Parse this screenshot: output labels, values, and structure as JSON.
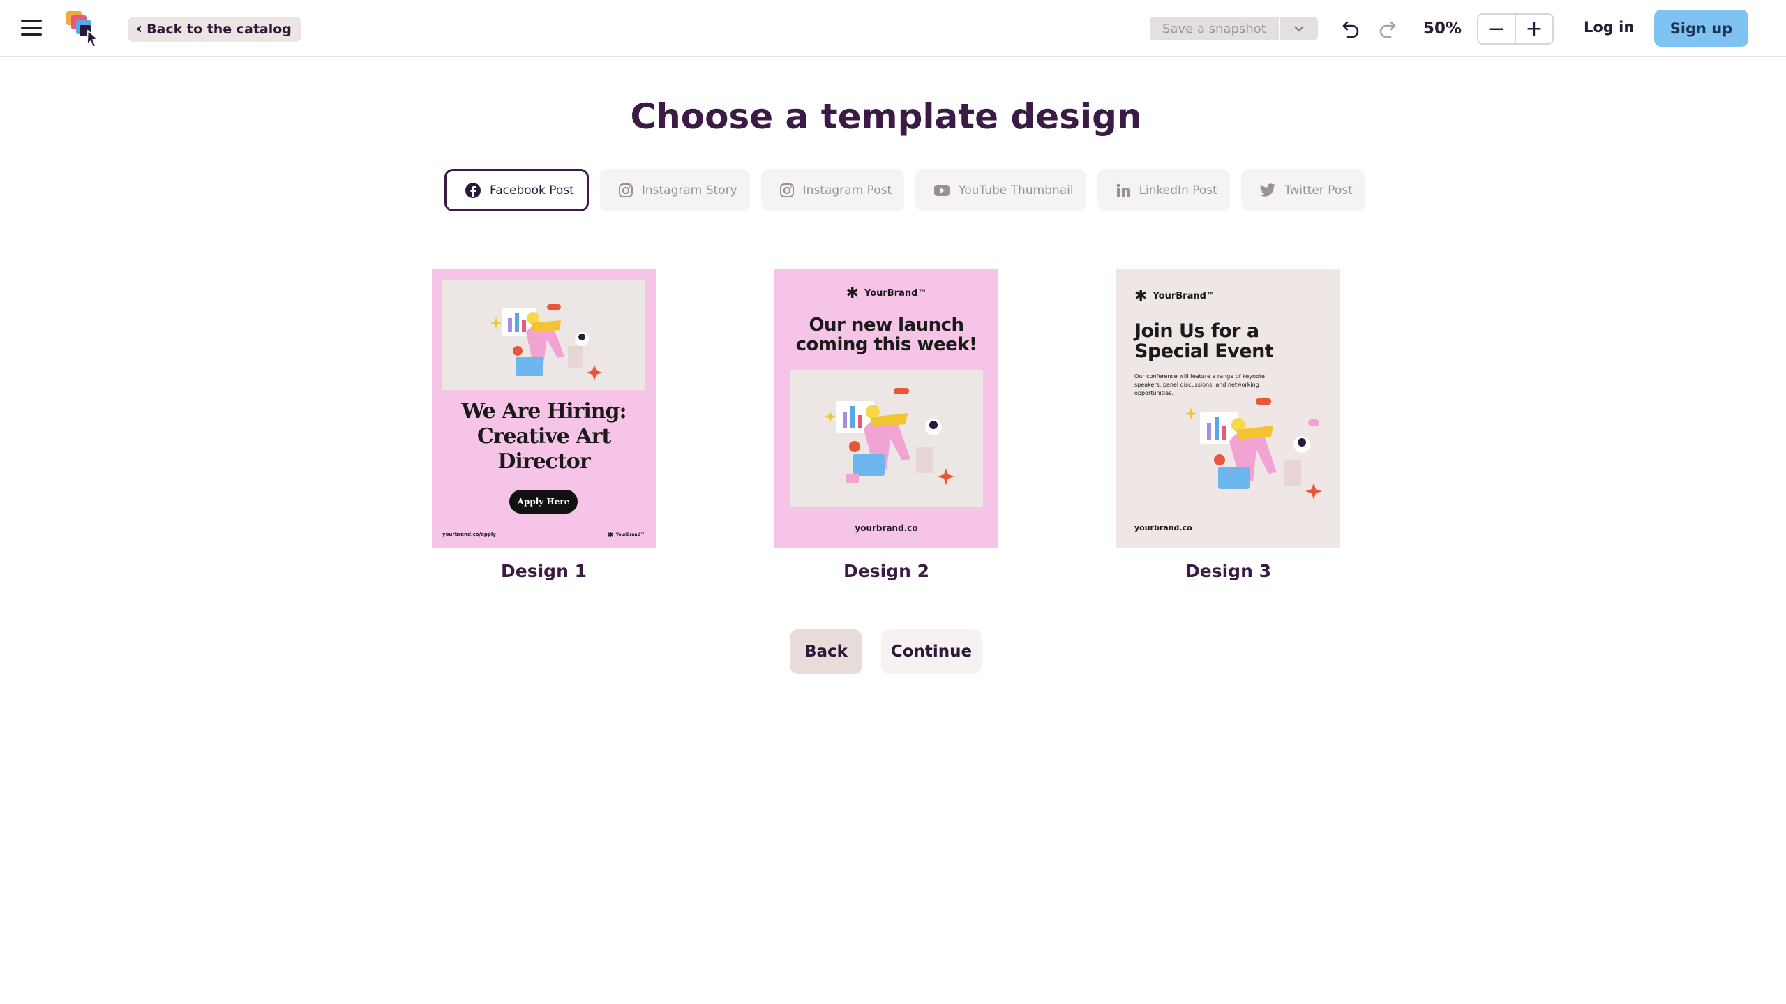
{
  "header": {
    "back_to_catalog": "Back to the catalog",
    "save_snapshot": "Save a snapshot",
    "zoom": "50%",
    "zoom_out": "−",
    "zoom_in": "+",
    "login": "Log in",
    "signup": "Sign up"
  },
  "main": {
    "title": "Choose a template design",
    "tabs": [
      {
        "label": "Facebook Post",
        "icon": "facebook-icon",
        "active": true
      },
      {
        "label": "Instagram Story",
        "icon": "instagram-icon",
        "active": false
      },
      {
        "label": "Instagram Post",
        "icon": "instagram-icon",
        "active": false
      },
      {
        "label": "YouTube Thumbnail",
        "icon": "youtube-icon",
        "active": false
      },
      {
        "label": "LinkedIn Post",
        "icon": "linkedin-icon",
        "active": false
      },
      {
        "label": "Twitter Post",
        "icon": "twitter-icon",
        "active": false
      }
    ],
    "designs": [
      {
        "label": "Design 1",
        "headline": "We Are Hiring: Creative Art Director",
        "cta": "Apply Here",
        "footer_left": "yourbrand.co/apply",
        "footer_right": "YourBrand™"
      },
      {
        "label": "Design 2",
        "brand": "YourBrand™",
        "headline": "Our new launch coming this week!",
        "footer": "yourbrand.co"
      },
      {
        "label": "Design 3",
        "brand": "YourBrand™",
        "headline": "Join Us for a Special Event",
        "body": "Our conference will feature a range of keynote speakers, panel discussions, and networking opportunities.",
        "footer": "yourbrand.co"
      }
    ],
    "back": "Back",
    "continue": "Continue"
  },
  "colors": {
    "pink_bg": "#f5c4e6",
    "signup_bg": "#7fc3f3",
    "title": "#3b1a45"
  }
}
